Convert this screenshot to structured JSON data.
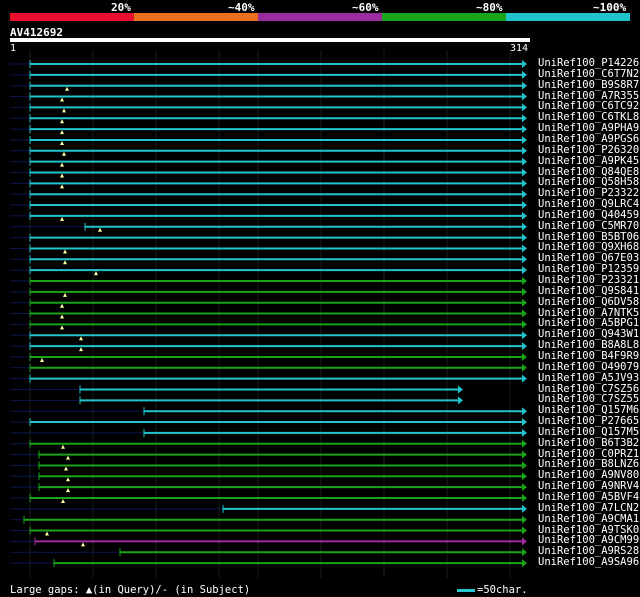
{
  "legend": [
    {
      "label": "20%",
      "color": "#e8102e"
    },
    {
      "label": "~40%",
      "color": "#e8701e"
    },
    {
      "label": "~60%",
      "color": "#9b2c9e"
    },
    {
      "label": "~80%",
      "color": "#19a419"
    },
    {
      "label": "~100%",
      "color": "#20c4cc"
    }
  ],
  "query": {
    "id": "AV412692",
    "start": "1",
    "end": "314"
  },
  "footer": {
    "gaps_text": "Large gaps: ▲(in Query)/- (in Subject)",
    "scale_text": "=50char."
  },
  "hits": [
    {
      "id": "UniRef100_P14226",
      "start": 30,
      "end": 522,
      "color": "cyan",
      "gap": null,
      "arrow": true
    },
    {
      "id": "UniRef100_C6T7N2",
      "start": 30,
      "end": 522,
      "color": "cyan",
      "gap": null,
      "arrow": true
    },
    {
      "id": "UniRef100_B9S8R7",
      "start": 30,
      "end": 522,
      "color": "cyan",
      "gap": 67,
      "arrow": true
    },
    {
      "id": "UniRef100_A7R355",
      "start": 30,
      "end": 522,
      "color": "cyan",
      "gap": 62,
      "arrow": true
    },
    {
      "id": "UniRef100_C6TC92",
      "start": 30,
      "end": 522,
      "color": "cyan",
      "gap": 64,
      "arrow": true
    },
    {
      "id": "UniRef100_C6TKL8",
      "start": 30,
      "end": 522,
      "color": "cyan",
      "gap": 62,
      "arrow": true
    },
    {
      "id": "UniRef100_A9PHA9",
      "start": 30,
      "end": 522,
      "color": "cyan",
      "gap": 62,
      "arrow": true
    },
    {
      "id": "UniRef100_A9PGS6",
      "start": 30,
      "end": 522,
      "color": "cyan",
      "gap": 62,
      "arrow": true
    },
    {
      "id": "UniRef100_P26320",
      "start": 30,
      "end": 522,
      "color": "cyan",
      "gap": 64,
      "arrow": true
    },
    {
      "id": "UniRef100_A9PK45",
      "start": 30,
      "end": 522,
      "color": "cyan",
      "gap": 62,
      "arrow": true
    },
    {
      "id": "UniRef100_Q84QE8",
      "start": 30,
      "end": 522,
      "color": "cyan",
      "gap": 62,
      "arrow": true
    },
    {
      "id": "UniRef100_Q58H58",
      "start": 30,
      "end": 522,
      "color": "cyan",
      "gap": 62,
      "arrow": true
    },
    {
      "id": "UniRef100_P23322",
      "start": 30,
      "end": 522,
      "color": "cyan",
      "gap": null,
      "arrow": true
    },
    {
      "id": "UniRef100_Q9LRC4",
      "start": 30,
      "end": 522,
      "color": "cyan",
      "gap": null,
      "arrow": true
    },
    {
      "id": "UniRef100_Q40459",
      "start": 30,
      "end": 522,
      "color": "cyan",
      "gap": 62,
      "arrow": true
    },
    {
      "id": "UniRef100_C5MR70",
      "start": 85,
      "end": 522,
      "color": "cyan",
      "gap": 100,
      "arrow": true
    },
    {
      "id": "UniRef100_B5BT06",
      "start": 30,
      "end": 522,
      "color": "cyan",
      "gap": null,
      "arrow": true
    },
    {
      "id": "UniRef100_Q9XH68",
      "start": 30,
      "end": 522,
      "color": "cyan",
      "gap": 65,
      "arrow": true
    },
    {
      "id": "UniRef100_Q67E03",
      "start": 30,
      "end": 522,
      "color": "cyan",
      "gap": 65,
      "arrow": true
    },
    {
      "id": "UniRef100_P12359",
      "start": 30,
      "end": 522,
      "color": "cyan",
      "gap": 96,
      "arrow": true
    },
    {
      "id": "UniRef100_P23321",
      "start": 30,
      "end": 522,
      "color": "green",
      "gap": null,
      "arrow": true
    },
    {
      "id": "UniRef100_Q9S841",
      "start": 30,
      "end": 522,
      "color": "green",
      "gap": 65,
      "arrow": true
    },
    {
      "id": "UniRef100_Q6DV58",
      "start": 30,
      "end": 522,
      "color": "green",
      "gap": 62,
      "arrow": true
    },
    {
      "id": "UniRef100_A7NTK5",
      "start": 30,
      "end": 522,
      "color": "green",
      "gap": 62,
      "arrow": true
    },
    {
      "id": "UniRef100_A5BPG1",
      "start": 30,
      "end": 522,
      "color": "green",
      "gap": 62,
      "arrow": true
    },
    {
      "id": "UniRef100_Q943W1",
      "start": 30,
      "end": 522,
      "color": "cyan",
      "gap": 81,
      "arrow": true
    },
    {
      "id": "UniRef100_B8A8L8",
      "start": 30,
      "end": 522,
      "color": "cyan",
      "gap": 81,
      "arrow": true
    },
    {
      "id": "UniRef100_B4F9R9",
      "start": 30,
      "end": 522,
      "color": "green",
      "gap": 42,
      "arrow": true
    },
    {
      "id": "UniRef100_O49079",
      "start": 30,
      "end": 522,
      "color": "green",
      "gap": null,
      "arrow": true
    },
    {
      "id": "UniRef100_A5JV93",
      "start": 30,
      "end": 522,
      "color": "cyan",
      "gap": null,
      "arrow": true
    },
    {
      "id": "UniRef100_C7SZ56",
      "start": 80,
      "end": 458,
      "color": "cyan",
      "gap": null,
      "arrow": true
    },
    {
      "id": "UniRef100_C7SZ55",
      "start": 80,
      "end": 458,
      "color": "cyan",
      "gap": null,
      "arrow": true
    },
    {
      "id": "UniRef100_Q157M6",
      "start": 144,
      "end": 522,
      "color": "cyan",
      "gap": null,
      "arrow": true
    },
    {
      "id": "UniRef100_P27665",
      "start": 30,
      "end": 522,
      "color": "cyan",
      "gap": null,
      "arrow": true
    },
    {
      "id": "UniRef100_Q157M5",
      "start": 144,
      "end": 522,
      "color": "cyan",
      "gap": null,
      "arrow": true
    },
    {
      "id": "UniRef100_B6T3B2",
      "start": 30,
      "end": 522,
      "color": "green",
      "gap": 63,
      "arrow": true
    },
    {
      "id": "UniRef100_C0PRZ1",
      "start": 39,
      "end": 522,
      "color": "green",
      "gap": 68,
      "arrow": true
    },
    {
      "id": "UniRef100_B8LNZ6",
      "start": 39,
      "end": 522,
      "color": "green",
      "gap": 66,
      "arrow": true
    },
    {
      "id": "UniRef100_A9NV80",
      "start": 39,
      "end": 522,
      "color": "green",
      "gap": 68,
      "arrow": true
    },
    {
      "id": "UniRef100_A9NRV4",
      "start": 39,
      "end": 522,
      "color": "green",
      "gap": 68,
      "arrow": true
    },
    {
      "id": "UniRef100_A5BVF4",
      "start": 30,
      "end": 522,
      "color": "green",
      "gap": 63,
      "arrow": true
    },
    {
      "id": "UniRef100_A7LCN2",
      "start": 223,
      "end": 522,
      "color": "cyan",
      "gap": null,
      "arrow": true
    },
    {
      "id": "UniRef100_A9CMA1",
      "start": 24,
      "end": 522,
      "color": "green",
      "gap": null,
      "arrow": true
    },
    {
      "id": "UniRef100_A9TSK0",
      "start": 30,
      "end": 522,
      "color": "green",
      "gap": 47,
      "arrow": true
    },
    {
      "id": "UniRef100_A9CM99",
      "start": 35,
      "end": 522,
      "color": "purple",
      "gap": 83,
      "arrow": true
    },
    {
      "id": "UniRef100_A9RS28",
      "start": 120,
      "end": 522,
      "color": "green",
      "gap": null,
      "arrow": true
    },
    {
      "id": "UniRef100_A9SA96",
      "start": 54,
      "end": 522,
      "color": "green",
      "gap": null,
      "arrow": true
    }
  ]
}
